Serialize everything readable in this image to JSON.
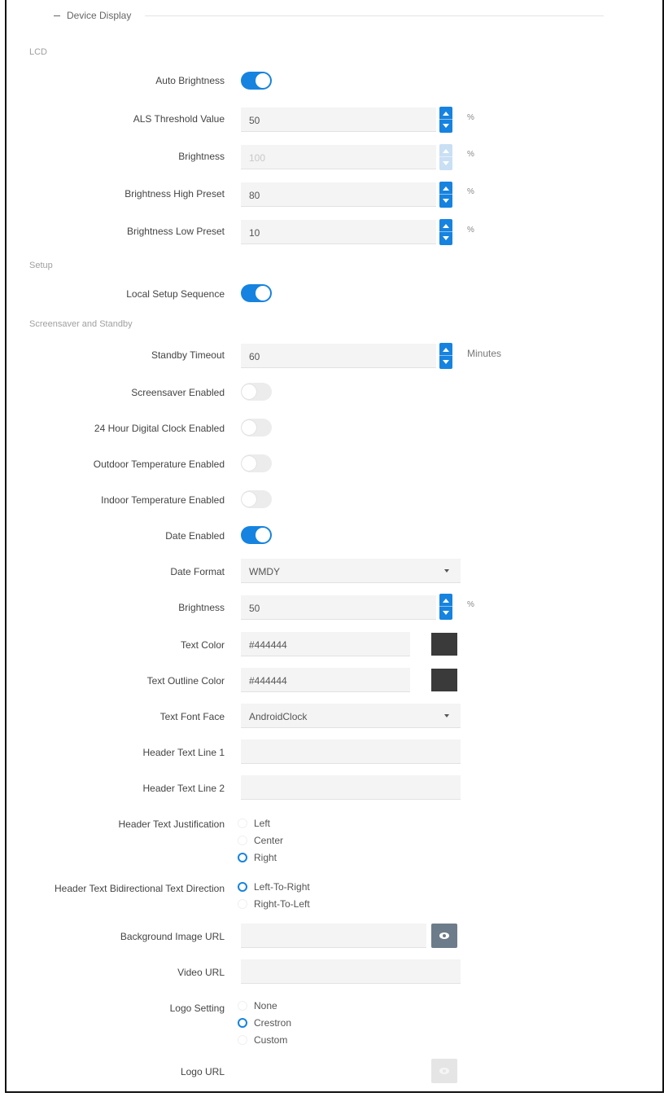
{
  "section": {
    "title": "Device Display"
  },
  "groups": {
    "lcd": "LCD",
    "setup": "Setup",
    "screensaver": "Screensaver and Standby"
  },
  "labels": {
    "auto_brightness": "Auto Brightness",
    "als_threshold": "ALS Threshold Value",
    "brightness": "Brightness",
    "brightness_high": "Brightness High Preset",
    "brightness_low": "Brightness Low Preset",
    "local_setup": "Local Setup Sequence",
    "standby_timeout": "Standby Timeout",
    "screensaver_enabled": "Screensaver Enabled",
    "clock_enabled": "24 Hour Digital Clock Enabled",
    "outdoor_temp": "Outdoor Temperature Enabled",
    "indoor_temp": "Indoor Temperature Enabled",
    "date_enabled": "Date Enabled",
    "date_format": "Date Format",
    "ss_brightness": "Brightness",
    "text_color": "Text Color",
    "text_outline_color": "Text Outline Color",
    "text_font_face": "Text Font Face",
    "header_line1": "Header Text Line 1",
    "header_line2": "Header Text Line 2",
    "header_justification": "Header Text Justification",
    "header_direction": "Header Text Bidirectional Text Direction",
    "bg_image_url": "Background Image URL",
    "video_url": "Video URL",
    "logo_setting": "Logo Setting",
    "logo_url": "Logo URL"
  },
  "values": {
    "als_threshold": "50",
    "brightness": "100",
    "brightness_high": "80",
    "brightness_low": "10",
    "standby_timeout": "60",
    "date_format": "WMDY",
    "ss_brightness": "50",
    "text_color": "#444444",
    "text_outline_color": "#444444",
    "text_font_face": "AndroidClock",
    "header_line1": "",
    "header_line2": "",
    "bg_image_url": "",
    "video_url": "",
    "logo_url": ""
  },
  "units": {
    "percent": "%",
    "minutes": "Minutes"
  },
  "toggles": {
    "auto_brightness": true,
    "local_setup": true,
    "screensaver_enabled": false,
    "clock_enabled": false,
    "outdoor_temp": false,
    "indoor_temp": false,
    "date_enabled": true
  },
  "justification_options": [
    "Left",
    "Center",
    "Right"
  ],
  "justification_selected": "Right",
  "direction_options": [
    "Left-To-Right",
    "Right-To-Left"
  ],
  "direction_selected": "Left-To-Right",
  "logo_options": [
    "None",
    "Crestron",
    "Custom"
  ],
  "logo_selected": "Crestron",
  "colors": {
    "accent": "#1683e0",
    "swatch": "#3a3a3a",
    "icon_button": "#6d7c8a"
  },
  "icons": {
    "collapse": "minus-icon",
    "preview": "eye-icon"
  }
}
